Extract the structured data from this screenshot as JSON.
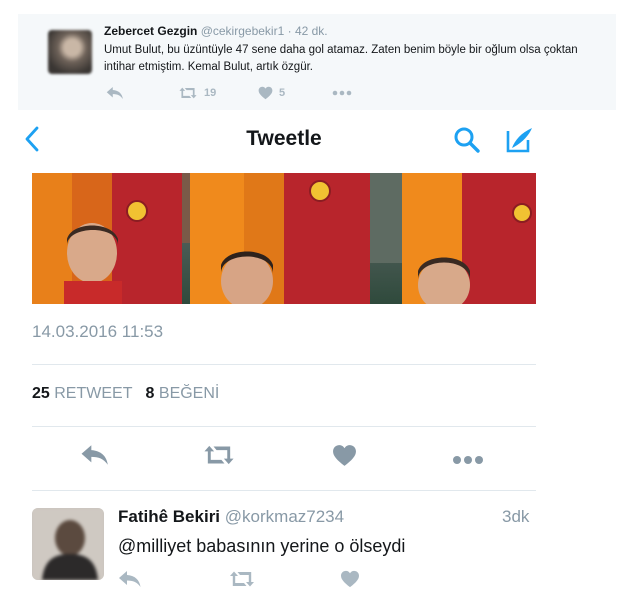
{
  "top_tweet": {
    "name": "Zebercet Gezgin",
    "handle": "@cekirgebekir1",
    "separator": "·",
    "time": "42 dk.",
    "text": "Umut Bulut, bu üzüntüyle 47 sene daha gol atamaz. Zaten benim böyle bir oğlum olsa çoktan intihar etmiştim. Kemal Bulut, artık özgür.",
    "retweet_count": "19",
    "like_count": "5",
    "icons": [
      "reply-icon",
      "retweet-icon",
      "heart-icon",
      "more-icon"
    ]
  },
  "nav": {
    "title": "Tweetle",
    "icons": [
      "back-chevron-icon",
      "search-icon",
      "compose-icon"
    ]
  },
  "tweet_detail": {
    "timestamp": "14.03.2016 11:53",
    "retweets": "25",
    "retweets_label": "RETWEET",
    "likes": "8",
    "likes_label": "BEĞENİ",
    "icons": [
      "reply-icon",
      "retweet-icon",
      "heart-icon",
      "more-icon"
    ]
  },
  "reply": {
    "name": "Fatihê Bekiri",
    "handle": "@korkmaz7234",
    "time": "3dk",
    "text": "@milliyet babasının yerine o ölseydi",
    "icons": [
      "reply-icon",
      "retweet-icon",
      "heart-icon"
    ]
  },
  "colors": {
    "accent": "#1da1f2",
    "muted": "#8899a6",
    "icon_gray": "#aab8c2",
    "divider": "#e1e8ed",
    "kit_orange": "#f08a1c",
    "kit_red": "#b8252c"
  }
}
